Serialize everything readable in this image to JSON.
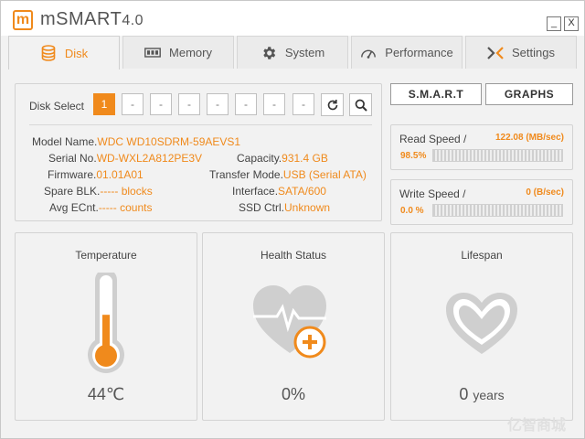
{
  "app": {
    "logo_letter": "m",
    "title": "mSMART",
    "version": "4.0",
    "minimize_label": "_",
    "close_label": "X"
  },
  "tabs": [
    {
      "label": "Disk",
      "icon": "disk-icon",
      "active": true
    },
    {
      "label": "Memory",
      "icon": "memory-icon",
      "active": false
    },
    {
      "label": "System",
      "icon": "gear-icon",
      "active": false
    },
    {
      "label": "Performance",
      "icon": "speedometer-icon",
      "active": false
    },
    {
      "label": "Settings",
      "icon": "settings-icon",
      "active": false
    }
  ],
  "disk_select": {
    "label": "Disk Select",
    "slots": [
      "1",
      "-",
      "-",
      "-",
      "-",
      "-",
      "-",
      "-"
    ],
    "selected": "1"
  },
  "info": {
    "model_name": {
      "label": "Model Name.",
      "value": "WDC WD10SDRM-59AEVS1"
    },
    "serial_no": {
      "label": "Serial No.",
      "value": "WD-WXL2A812PE3V"
    },
    "firmware": {
      "label": "Firmware.",
      "value": "01.01A01"
    },
    "spare_blk": {
      "label": "Spare BLK.",
      "value": "----- blocks"
    },
    "avg_ecnt": {
      "label": "Avg ECnt.",
      "value": "----- counts"
    },
    "capacity": {
      "label": "Capacity.",
      "value": "931.4 GB"
    },
    "transfer_mode": {
      "label": "Transfer Mode.",
      "value": "USB (Serial ATA)"
    },
    "interface": {
      "label": "Interface.",
      "value": "SATA/600"
    },
    "ssd_ctrl": {
      "label": "SSD Ctrl.",
      "value": "Unknown"
    }
  },
  "buttons": {
    "smart": "S.M.A.R.T",
    "graphs": "GRAPHS"
  },
  "read_speed": {
    "label": "Read Speed /",
    "value": "122.08 (MB/sec)",
    "percent": "98.5%"
  },
  "write_speed": {
    "label": "Write Speed /",
    "value": "0 (B/sec)",
    "percent": "0.0 %"
  },
  "cards": {
    "temperature": {
      "title": "Temperature",
      "value": "44℃",
      "fill_fraction": 0.55
    },
    "health": {
      "title": "Health Status",
      "value": "0%"
    },
    "lifespan": {
      "title": "Lifespan",
      "value": "0",
      "unit": "years"
    }
  },
  "watermark": "亿智商城",
  "colors": {
    "accent": "#f08a1c",
    "icon_gray": "#cfcfcf",
    "text": "#444444"
  }
}
